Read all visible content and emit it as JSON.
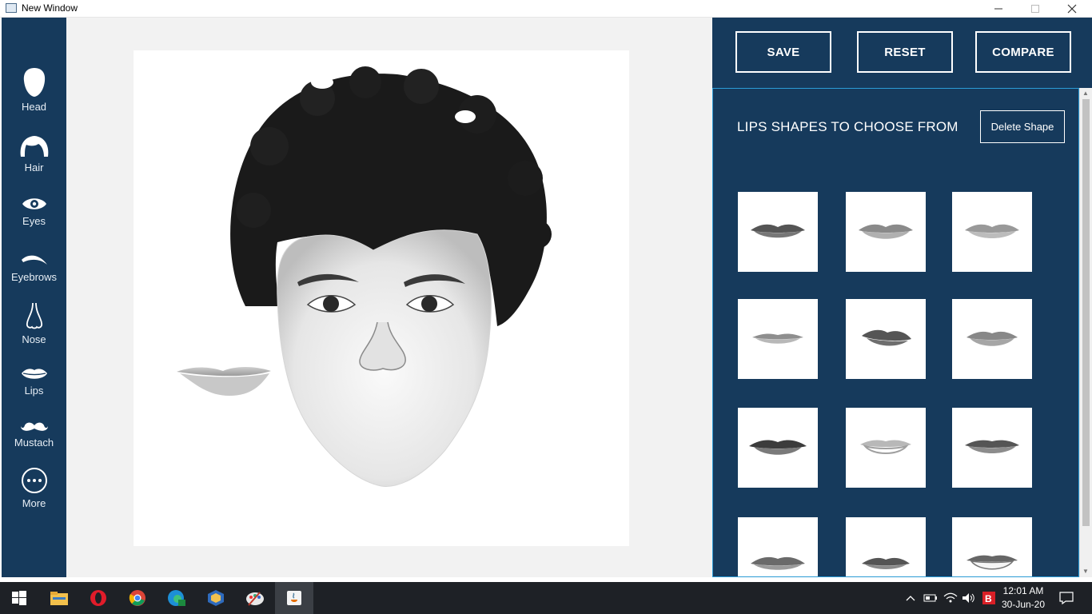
{
  "window": {
    "title": "New Window"
  },
  "sidebar": {
    "tools": [
      {
        "label": "Head",
        "icon": "head-icon"
      },
      {
        "label": "Hair",
        "icon": "hair-icon"
      },
      {
        "label": "Eyes",
        "icon": "eye-icon"
      },
      {
        "label": "Eyebrows",
        "icon": "eyebrow-icon"
      },
      {
        "label": "Nose",
        "icon": "nose-icon"
      },
      {
        "label": "Lips",
        "icon": "lips-icon"
      },
      {
        "label": "Mustach",
        "icon": "mustache-icon"
      },
      {
        "label": "More",
        "icon": "more-icon"
      }
    ]
  },
  "toolbar": {
    "save_label": "SAVE",
    "reset_label": "RESET",
    "compare_label": "COMPARE"
  },
  "panel": {
    "title": "LIPS SHAPES TO CHOOSE FROM",
    "delete_label": "Delete Shape",
    "thumbnails": [
      "lips-shape-1",
      "lips-shape-2",
      "lips-shape-3",
      "lips-shape-4",
      "lips-shape-5",
      "lips-shape-6",
      "lips-shape-7",
      "lips-shape-8",
      "lips-shape-9",
      "lips-shape-10",
      "lips-shape-11",
      "lips-shape-12"
    ]
  },
  "taskbar": {
    "apps": [
      "windows-start-icon",
      "file-explorer-icon",
      "opera-icon",
      "chrome-icon",
      "edge-icon",
      "virtualbox-icon",
      "paint-icon",
      "java-icon"
    ],
    "time": "12:01 AM",
    "date": "30-Jun-20"
  },
  "colors": {
    "panel_bg": "#163a5c",
    "accent_border": "#2b9bd6"
  }
}
